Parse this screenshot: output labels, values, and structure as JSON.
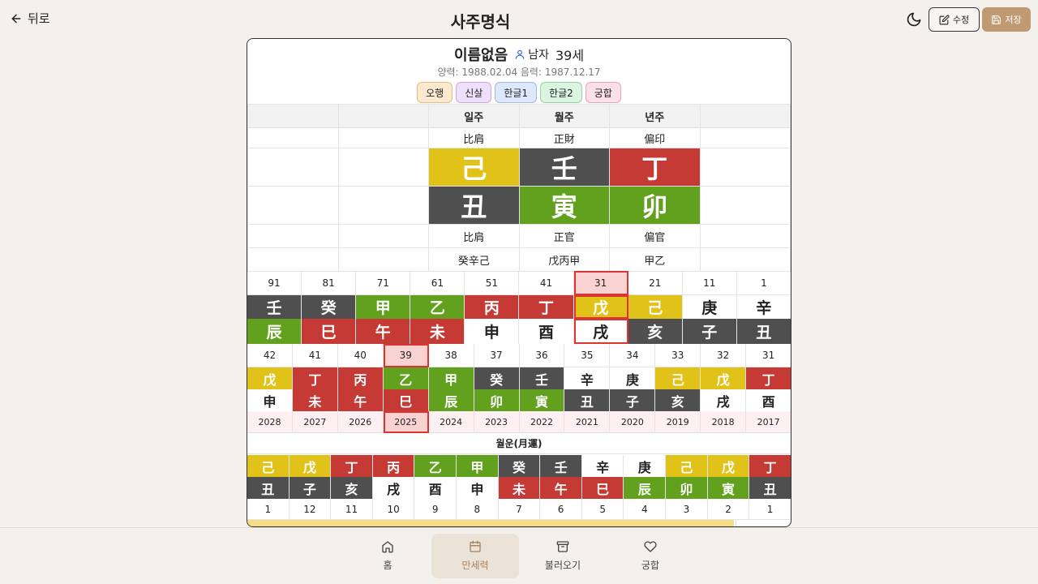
{
  "header": {
    "back_label": "뒤로",
    "title": "사주명식",
    "edit_label": "수정",
    "save_label": "저장"
  },
  "profile": {
    "name": "이름없음",
    "gender": "남자",
    "age": "39세",
    "dates": "양력: 1988.02.04 음력: 1987.12.17"
  },
  "chips": [
    {
      "label": "오행",
      "bg": "#fde9cf",
      "border": "#e7b97c"
    },
    {
      "label": "신살",
      "bg": "#eee0fa",
      "border": "#c9a7ea"
    },
    {
      "label": "한글1",
      "bg": "#dde9fb",
      "border": "#9ab9ea"
    },
    {
      "label": "한글2",
      "bg": "#dbf5e1",
      "border": "#94d6a4"
    },
    {
      "label": "궁합",
      "bg": "#fbe0ea",
      "border": "#eaa3bb"
    }
  ],
  "pillars": {
    "headers": [
      "",
      "",
      "일주",
      "월주",
      "년주",
      ""
    ],
    "stem_gods": [
      "",
      "",
      "比肩",
      "正財",
      "偏印",
      ""
    ],
    "stems": [
      {
        "char": "己",
        "bg": "#e1c218"
      },
      {
        "char": "壬",
        "bg": "#4f4f4f"
      },
      {
        "char": "丁",
        "bg": "#c53a35"
      }
    ],
    "branches": [
      {
        "char": "丑",
        "bg": "#4f4f4f"
      },
      {
        "char": "寅",
        "bg": "#62a11e"
      },
      {
        "char": "卯",
        "bg": "#62a11e"
      }
    ],
    "branch_gods": [
      "",
      "",
      "比肩",
      "正官",
      "偏官",
      ""
    ],
    "hidden": [
      "",
      "",
      "癸辛己",
      "戊丙甲",
      "甲乙",
      ""
    ]
  },
  "daeun": {
    "ages": [
      "91",
      "81",
      "71",
      "61",
      "51",
      "41",
      "31",
      "21",
      "11",
      "1"
    ],
    "selected_index": 6,
    "stems": [
      {
        "c": "壬",
        "bg": "#4f4f4f",
        "fg": "#fff"
      },
      {
        "c": "癸",
        "bg": "#4f4f4f",
        "fg": "#fff"
      },
      {
        "c": "甲",
        "bg": "#62a11e",
        "fg": "#fff"
      },
      {
        "c": "乙",
        "bg": "#62a11e",
        "fg": "#fff"
      },
      {
        "c": "丙",
        "bg": "#c53a35",
        "fg": "#fff"
      },
      {
        "c": "丁",
        "bg": "#c53a35",
        "fg": "#fff"
      },
      {
        "c": "戊",
        "bg": "#e1c218",
        "fg": "#fff"
      },
      {
        "c": "己",
        "bg": "#e1c218",
        "fg": "#fff"
      },
      {
        "c": "庚",
        "bg": "#ffffff",
        "fg": "#222"
      },
      {
        "c": "辛",
        "bg": "#ffffff",
        "fg": "#222"
      }
    ],
    "branches": [
      {
        "c": "辰",
        "bg": "#62a11e",
        "fg": "#fff"
      },
      {
        "c": "巳",
        "bg": "#c53a35",
        "fg": "#fff"
      },
      {
        "c": "午",
        "bg": "#c53a35",
        "fg": "#fff"
      },
      {
        "c": "未",
        "bg": "#c53a35",
        "fg": "#fff"
      },
      {
        "c": "申",
        "bg": "#ffffff",
        "fg": "#222"
      },
      {
        "c": "酉",
        "bg": "#ffffff",
        "fg": "#222"
      },
      {
        "c": "戌",
        "bg": "#ffffff",
        "fg": "#222"
      },
      {
        "c": "亥",
        "bg": "#4f4f4f",
        "fg": "#fff"
      },
      {
        "c": "子",
        "bg": "#4f4f4f",
        "fg": "#fff"
      },
      {
        "c": "丑",
        "bg": "#4f4f4f",
        "fg": "#fff"
      }
    ]
  },
  "seun": {
    "ages": [
      "42",
      "41",
      "40",
      "39",
      "38",
      "37",
      "36",
      "35",
      "34",
      "33",
      "32",
      "31"
    ],
    "selected_index": 3,
    "stems": [
      {
        "c": "戊",
        "bg": "#e1c218",
        "fg": "#fff"
      },
      {
        "c": "丁",
        "bg": "#c53a35",
        "fg": "#fff"
      },
      {
        "c": "丙",
        "bg": "#c53a35",
        "fg": "#fff"
      },
      {
        "c": "乙",
        "bg": "#62a11e",
        "fg": "#fff"
      },
      {
        "c": "甲",
        "bg": "#62a11e",
        "fg": "#fff"
      },
      {
        "c": "癸",
        "bg": "#4f4f4f",
        "fg": "#fff"
      },
      {
        "c": "壬",
        "bg": "#4f4f4f",
        "fg": "#fff"
      },
      {
        "c": "辛",
        "bg": "#ffffff",
        "fg": "#222"
      },
      {
        "c": "庚",
        "bg": "#ffffff",
        "fg": "#222"
      },
      {
        "c": "己",
        "bg": "#e1c218",
        "fg": "#fff"
      },
      {
        "c": "戊",
        "bg": "#e1c218",
        "fg": "#fff"
      },
      {
        "c": "丁",
        "bg": "#c53a35",
        "fg": "#fff"
      }
    ],
    "branches": [
      {
        "c": "申",
        "bg": "#ffffff",
        "fg": "#222"
      },
      {
        "c": "未",
        "bg": "#c53a35",
        "fg": "#fff"
      },
      {
        "c": "午",
        "bg": "#c53a35",
        "fg": "#fff"
      },
      {
        "c": "巳",
        "bg": "#c53a35",
        "fg": "#fff"
      },
      {
        "c": "辰",
        "bg": "#62a11e",
        "fg": "#fff"
      },
      {
        "c": "卯",
        "bg": "#62a11e",
        "fg": "#fff"
      },
      {
        "c": "寅",
        "bg": "#62a11e",
        "fg": "#fff"
      },
      {
        "c": "丑",
        "bg": "#4f4f4f",
        "fg": "#fff"
      },
      {
        "c": "子",
        "bg": "#4f4f4f",
        "fg": "#fff"
      },
      {
        "c": "亥",
        "bg": "#4f4f4f",
        "fg": "#fff"
      },
      {
        "c": "戌",
        "bg": "#ffffff",
        "fg": "#222"
      },
      {
        "c": "酉",
        "bg": "#ffffff",
        "fg": "#222"
      }
    ],
    "years": [
      "2028",
      "2027",
      "2026",
      "2025",
      "2024",
      "2023",
      "2022",
      "2021",
      "2020",
      "2019",
      "2018",
      "2017"
    ]
  },
  "wolun": {
    "title": "월운(月運)",
    "stems": [
      {
        "c": "己",
        "bg": "#e1c218",
        "fg": "#fff"
      },
      {
        "c": "戊",
        "bg": "#e1c218",
        "fg": "#fff"
      },
      {
        "c": "丁",
        "bg": "#c53a35",
        "fg": "#fff"
      },
      {
        "c": "丙",
        "bg": "#c53a35",
        "fg": "#fff"
      },
      {
        "c": "乙",
        "bg": "#62a11e",
        "fg": "#fff"
      },
      {
        "c": "甲",
        "bg": "#62a11e",
        "fg": "#fff"
      },
      {
        "c": "癸",
        "bg": "#4f4f4f",
        "fg": "#fff"
      },
      {
        "c": "壬",
        "bg": "#4f4f4f",
        "fg": "#fff"
      },
      {
        "c": "辛",
        "bg": "#ffffff",
        "fg": "#222"
      },
      {
        "c": "庚",
        "bg": "#ffffff",
        "fg": "#222"
      },
      {
        "c": "己",
        "bg": "#e1c218",
        "fg": "#fff"
      },
      {
        "c": "戊",
        "bg": "#e1c218",
        "fg": "#fff"
      },
      {
        "c": "丁",
        "bg": "#c53a35",
        "fg": "#fff"
      }
    ],
    "branches": [
      {
        "c": "丑",
        "bg": "#4f4f4f",
        "fg": "#fff"
      },
      {
        "c": "子",
        "bg": "#4f4f4f",
        "fg": "#fff"
      },
      {
        "c": "亥",
        "bg": "#4f4f4f",
        "fg": "#fff"
      },
      {
        "c": "戌",
        "bg": "#ffffff",
        "fg": "#222"
      },
      {
        "c": "酉",
        "bg": "#ffffff",
        "fg": "#222"
      },
      {
        "c": "申",
        "bg": "#ffffff",
        "fg": "#222"
      },
      {
        "c": "未",
        "bg": "#c53a35",
        "fg": "#fff"
      },
      {
        "c": "午",
        "bg": "#c53a35",
        "fg": "#fff"
      },
      {
        "c": "巳",
        "bg": "#c53a35",
        "fg": "#fff"
      },
      {
        "c": "辰",
        "bg": "#62a11e",
        "fg": "#fff"
      },
      {
        "c": "卯",
        "bg": "#62a11e",
        "fg": "#fff"
      },
      {
        "c": "寅",
        "bg": "#62a11e",
        "fg": "#fff"
      },
      {
        "c": "丑",
        "bg": "#4f4f4f",
        "fg": "#fff"
      }
    ],
    "months": [
      "1",
      "12",
      "11",
      "10",
      "9",
      "8",
      "7",
      "6",
      "5",
      "4",
      "3",
      "2",
      "1"
    ]
  },
  "nav": [
    {
      "label": "홈",
      "icon": "home-icon",
      "active": false
    },
    {
      "label": "만세력",
      "icon": "calendar-icon",
      "active": true
    },
    {
      "label": "불러오기",
      "icon": "archive-icon",
      "active": false
    },
    {
      "label": "궁합",
      "icon": "heart-icon",
      "active": false
    }
  ]
}
